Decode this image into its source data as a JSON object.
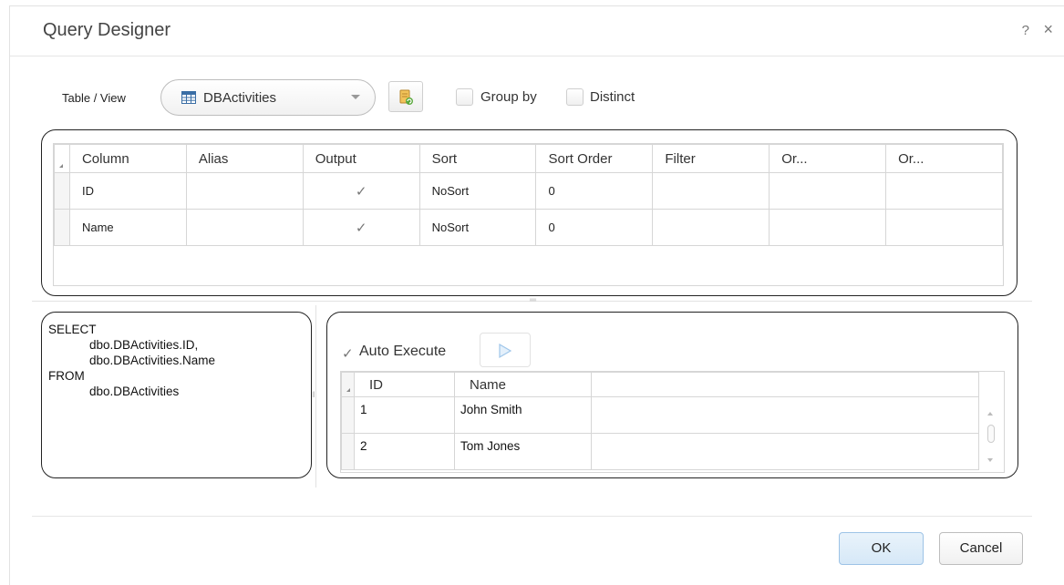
{
  "dialog": {
    "title": "Query Designer",
    "help": "?",
    "close": "×"
  },
  "toolbar": {
    "table_view_label": "Table / View",
    "table_value": "DBActivities",
    "table_icon": "table-icon",
    "refresh_icon": "refresh-table-icon",
    "group_by_label": "Group by",
    "group_by_checked": false,
    "distinct_label": "Distinct",
    "distinct_checked": false
  },
  "columns_grid": {
    "headers": [
      "Column",
      "Alias",
      "Output",
      "Sort",
      "Sort Order",
      "Filter",
      "Or...",
      "Or..."
    ],
    "rows": [
      {
        "column": "ID",
        "alias": "",
        "output": "✓",
        "sort": "NoSort",
        "sort_order": "0",
        "filter": "",
        "or1": "",
        "or2": ""
      },
      {
        "column": "Name",
        "alias": "",
        "output": "✓",
        "sort": "NoSort",
        "sort_order": "0",
        "filter": "",
        "or1": "",
        "or2": ""
      }
    ]
  },
  "sql": {
    "text": "SELECT\n            dbo.DBActivities.ID,\n            dbo.DBActivities.Name\nFROM\n            dbo.DBActivities"
  },
  "results": {
    "auto_execute_label": "Auto Execute",
    "auto_execute_checked": true,
    "run_icon": "play-icon",
    "headers": [
      "ID",
      "Name"
    ],
    "rows": [
      {
        "id": "1",
        "name": "John Smith"
      },
      {
        "id": "2",
        "name": "Tom Jones"
      }
    ]
  },
  "footer": {
    "ok_label": "OK",
    "cancel_label": "Cancel"
  },
  "colors": {
    "panel_border": "#222222",
    "grid_line": "#d6d6d6",
    "ok_button": "#d6e8f7"
  }
}
